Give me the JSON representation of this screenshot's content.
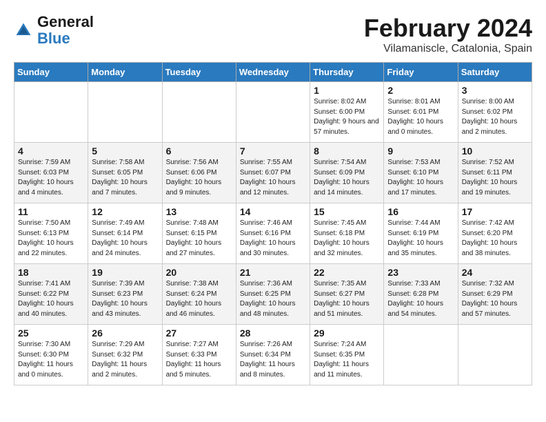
{
  "header": {
    "logo_text_general": "General",
    "logo_text_blue": "Blue",
    "month_title": "February 2024",
    "location": "Vilamaniscle, Catalonia, Spain"
  },
  "weekdays": [
    "Sunday",
    "Monday",
    "Tuesday",
    "Wednesday",
    "Thursday",
    "Friday",
    "Saturday"
  ],
  "weeks": [
    [
      {
        "day": "",
        "sunrise": "",
        "sunset": "",
        "daylight": ""
      },
      {
        "day": "",
        "sunrise": "",
        "sunset": "",
        "daylight": ""
      },
      {
        "day": "",
        "sunrise": "",
        "sunset": "",
        "daylight": ""
      },
      {
        "day": "",
        "sunrise": "",
        "sunset": "",
        "daylight": ""
      },
      {
        "day": "1",
        "sunrise": "Sunrise: 8:02 AM",
        "sunset": "Sunset: 6:00 PM",
        "daylight": "Daylight: 9 hours and 57 minutes."
      },
      {
        "day": "2",
        "sunrise": "Sunrise: 8:01 AM",
        "sunset": "Sunset: 6:01 PM",
        "daylight": "Daylight: 10 hours and 0 minutes."
      },
      {
        "day": "3",
        "sunrise": "Sunrise: 8:00 AM",
        "sunset": "Sunset: 6:02 PM",
        "daylight": "Daylight: 10 hours and 2 minutes."
      }
    ],
    [
      {
        "day": "4",
        "sunrise": "Sunrise: 7:59 AM",
        "sunset": "Sunset: 6:03 PM",
        "daylight": "Daylight: 10 hours and 4 minutes."
      },
      {
        "day": "5",
        "sunrise": "Sunrise: 7:58 AM",
        "sunset": "Sunset: 6:05 PM",
        "daylight": "Daylight: 10 hours and 7 minutes."
      },
      {
        "day": "6",
        "sunrise": "Sunrise: 7:56 AM",
        "sunset": "Sunset: 6:06 PM",
        "daylight": "Daylight: 10 hours and 9 minutes."
      },
      {
        "day": "7",
        "sunrise": "Sunrise: 7:55 AM",
        "sunset": "Sunset: 6:07 PM",
        "daylight": "Daylight: 10 hours and 12 minutes."
      },
      {
        "day": "8",
        "sunrise": "Sunrise: 7:54 AM",
        "sunset": "Sunset: 6:09 PM",
        "daylight": "Daylight: 10 hours and 14 minutes."
      },
      {
        "day": "9",
        "sunrise": "Sunrise: 7:53 AM",
        "sunset": "Sunset: 6:10 PM",
        "daylight": "Daylight: 10 hours and 17 minutes."
      },
      {
        "day": "10",
        "sunrise": "Sunrise: 7:52 AM",
        "sunset": "Sunset: 6:11 PM",
        "daylight": "Daylight: 10 hours and 19 minutes."
      }
    ],
    [
      {
        "day": "11",
        "sunrise": "Sunrise: 7:50 AM",
        "sunset": "Sunset: 6:13 PM",
        "daylight": "Daylight: 10 hours and 22 minutes."
      },
      {
        "day": "12",
        "sunrise": "Sunrise: 7:49 AM",
        "sunset": "Sunset: 6:14 PM",
        "daylight": "Daylight: 10 hours and 24 minutes."
      },
      {
        "day": "13",
        "sunrise": "Sunrise: 7:48 AM",
        "sunset": "Sunset: 6:15 PM",
        "daylight": "Daylight: 10 hours and 27 minutes."
      },
      {
        "day": "14",
        "sunrise": "Sunrise: 7:46 AM",
        "sunset": "Sunset: 6:16 PM",
        "daylight": "Daylight: 10 hours and 30 minutes."
      },
      {
        "day": "15",
        "sunrise": "Sunrise: 7:45 AM",
        "sunset": "Sunset: 6:18 PM",
        "daylight": "Daylight: 10 hours and 32 minutes."
      },
      {
        "day": "16",
        "sunrise": "Sunrise: 7:44 AM",
        "sunset": "Sunset: 6:19 PM",
        "daylight": "Daylight: 10 hours and 35 minutes."
      },
      {
        "day": "17",
        "sunrise": "Sunrise: 7:42 AM",
        "sunset": "Sunset: 6:20 PM",
        "daylight": "Daylight: 10 hours and 38 minutes."
      }
    ],
    [
      {
        "day": "18",
        "sunrise": "Sunrise: 7:41 AM",
        "sunset": "Sunset: 6:22 PM",
        "daylight": "Daylight: 10 hours and 40 minutes."
      },
      {
        "day": "19",
        "sunrise": "Sunrise: 7:39 AM",
        "sunset": "Sunset: 6:23 PM",
        "daylight": "Daylight: 10 hours and 43 minutes."
      },
      {
        "day": "20",
        "sunrise": "Sunrise: 7:38 AM",
        "sunset": "Sunset: 6:24 PM",
        "daylight": "Daylight: 10 hours and 46 minutes."
      },
      {
        "day": "21",
        "sunrise": "Sunrise: 7:36 AM",
        "sunset": "Sunset: 6:25 PM",
        "daylight": "Daylight: 10 hours and 48 minutes."
      },
      {
        "day": "22",
        "sunrise": "Sunrise: 7:35 AM",
        "sunset": "Sunset: 6:27 PM",
        "daylight": "Daylight: 10 hours and 51 minutes."
      },
      {
        "day": "23",
        "sunrise": "Sunrise: 7:33 AM",
        "sunset": "Sunset: 6:28 PM",
        "daylight": "Daylight: 10 hours and 54 minutes."
      },
      {
        "day": "24",
        "sunrise": "Sunrise: 7:32 AM",
        "sunset": "Sunset: 6:29 PM",
        "daylight": "Daylight: 10 hours and 57 minutes."
      }
    ],
    [
      {
        "day": "25",
        "sunrise": "Sunrise: 7:30 AM",
        "sunset": "Sunset: 6:30 PM",
        "daylight": "Daylight: 11 hours and 0 minutes."
      },
      {
        "day": "26",
        "sunrise": "Sunrise: 7:29 AM",
        "sunset": "Sunset: 6:32 PM",
        "daylight": "Daylight: 11 hours and 2 minutes."
      },
      {
        "day": "27",
        "sunrise": "Sunrise: 7:27 AM",
        "sunset": "Sunset: 6:33 PM",
        "daylight": "Daylight: 11 hours and 5 minutes."
      },
      {
        "day": "28",
        "sunrise": "Sunrise: 7:26 AM",
        "sunset": "Sunset: 6:34 PM",
        "daylight": "Daylight: 11 hours and 8 minutes."
      },
      {
        "day": "29",
        "sunrise": "Sunrise: 7:24 AM",
        "sunset": "Sunset: 6:35 PM",
        "daylight": "Daylight: 11 hours and 11 minutes."
      },
      {
        "day": "",
        "sunrise": "",
        "sunset": "",
        "daylight": ""
      },
      {
        "day": "",
        "sunrise": "",
        "sunset": "",
        "daylight": ""
      }
    ]
  ]
}
